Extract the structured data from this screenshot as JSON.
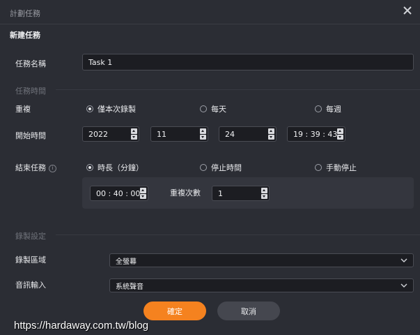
{
  "window": {
    "title": "計劃任務"
  },
  "heading": "新建任務",
  "task_name": {
    "label": "任務名稱",
    "value": "Task 1"
  },
  "section_time": "任務時間",
  "repeat": {
    "label": "重複",
    "options": [
      "僅本次錄製",
      "每天",
      "每週"
    ],
    "selected": 0
  },
  "start_time": {
    "label": "開始時間",
    "year": "2022",
    "month": "11",
    "day": "24",
    "time": "19 : 39 : 43"
  },
  "end_task": {
    "label": "結束任務",
    "info_icon": "info-icon",
    "options": [
      "時長（分鐘）",
      "停止時間",
      "手動停止"
    ],
    "selected": 0
  },
  "duration": {
    "value": "00 : 40 : 00"
  },
  "repeat_count": {
    "label": "重複次數",
    "value": "1"
  },
  "section_record": "錄製設定",
  "record_area": {
    "label": "錄製區域",
    "value": "全螢幕"
  },
  "audio_input": {
    "label": "音訊輸入",
    "value": "系統聲音"
  },
  "buttons": {
    "confirm": "確定",
    "cancel": "取消"
  },
  "watermark": "https://hardaway.com.tw/blog",
  "colors": {
    "accent": "#f5821f",
    "background": "#2b2d34",
    "input_bg": "#1c1d22",
    "cancel_bg": "#45474f"
  }
}
